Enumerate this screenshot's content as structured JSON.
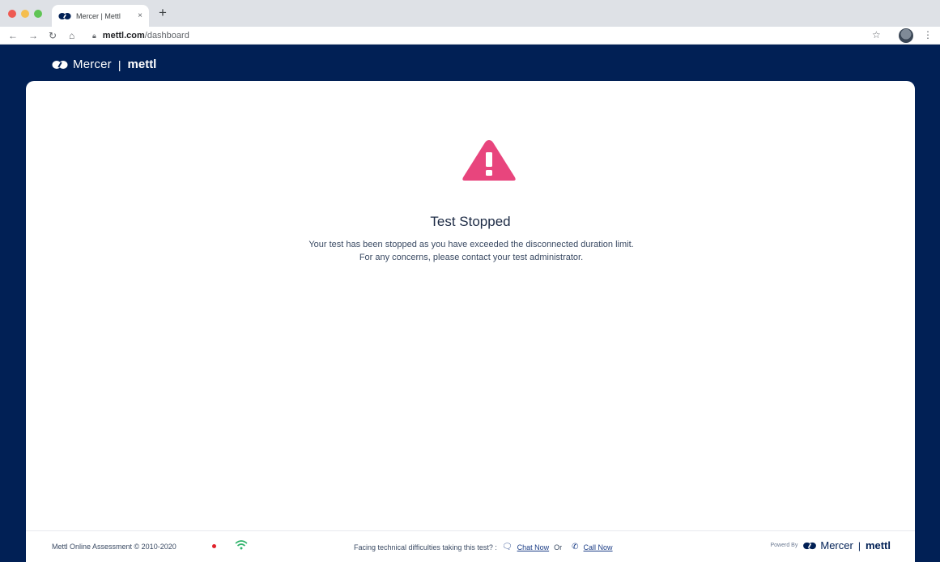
{
  "browser": {
    "tab_title": "Mercer | Mettl",
    "tab_close": "×",
    "new_tab": "+",
    "url_host": "mettl.com",
    "url_path": "/dashboard"
  },
  "header": {
    "brand_mercer": "Mercer",
    "brand_separator": "|",
    "brand_mettl": "mettl"
  },
  "main": {
    "title": "Test Stopped",
    "message": "Your test has been stopped as you have exceeded the disconnected duration limit. For any concerns, please contact your test administrator.",
    "alert_icon": "warning-triangle-icon",
    "alert_color": "#e8457d"
  },
  "footer": {
    "copyright": "Mettl Online Assessment © 2010-2020",
    "help_text": "Facing technical difficulties taking this test? :",
    "chat_now": "Chat Now",
    "or_text": "Or",
    "call_now": "Call Now",
    "powered_by": "Powerd By",
    "powered_mercer": "Mercer",
    "powered_separator": "|",
    "powered_mettl": "mettl"
  },
  "colors": {
    "navy": "#012055",
    "alert_pink": "#e8457d",
    "recording_red": "#e0212a",
    "wifi_green": "#2fb36b"
  }
}
